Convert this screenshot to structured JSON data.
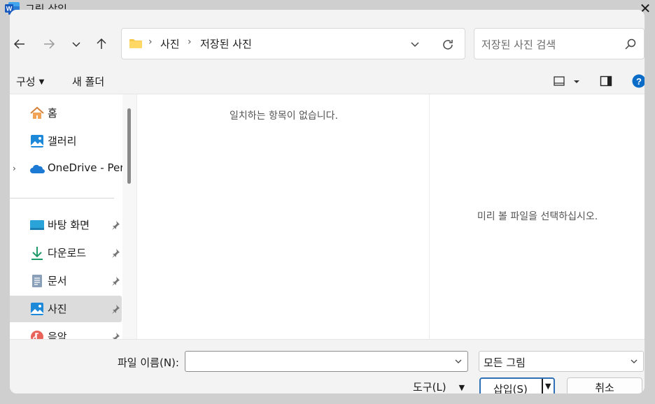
{
  "window": {
    "title": "그림 삽입",
    "close_label": "✕"
  },
  "address": {
    "crumbs": [
      "사진",
      "저장된 사진"
    ],
    "separator": "›"
  },
  "search": {
    "placeholder": "저장된 사진 검색"
  },
  "commands": {
    "organize": "구성",
    "new_folder": "새 폴더"
  },
  "sidebar": {
    "items": [
      {
        "label": "홈",
        "icon": "home-icon"
      },
      {
        "label": "갤러리",
        "icon": "gallery-icon"
      },
      {
        "label": "OneDrive - Pers",
        "icon": "onedrive-icon",
        "expandable": true
      },
      {
        "label": "바탕 화면",
        "icon": "desktop-icon",
        "pinned": true
      },
      {
        "label": "다운로드",
        "icon": "download-icon",
        "pinned": true
      },
      {
        "label": "문서",
        "icon": "documents-icon",
        "pinned": true
      },
      {
        "label": "사진",
        "icon": "pictures-icon",
        "pinned": true,
        "selected": true
      },
      {
        "label": "음악",
        "icon": "music-icon",
        "pinned": true
      }
    ]
  },
  "files": {
    "empty_message": "일치하는 항목이 없습니다."
  },
  "preview": {
    "message": "미리 볼 파일을 선택하십시오."
  },
  "bottom": {
    "filename_label": "파일 이름(N):",
    "filename_value": "",
    "filetype_value": "모든 그림",
    "tools_label": "도구(L)",
    "insert_label": "삽입(S)",
    "cancel_label": "취소"
  },
  "colors": {
    "accent": "#0a6cc7",
    "selected_bg": "#dcdcdc",
    "folder": "#f5c94a"
  }
}
